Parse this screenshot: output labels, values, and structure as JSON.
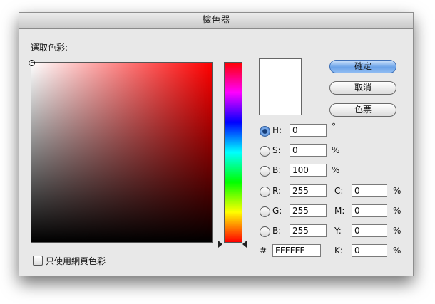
{
  "window": {
    "title": "檢色器"
  },
  "picker": {
    "label": "選取色彩:"
  },
  "buttons": {
    "ok": "確定",
    "cancel": "取消",
    "swatches": "色票"
  },
  "hsb": {
    "h": {
      "label": "H:",
      "value": "0",
      "unit": "°",
      "selected": true
    },
    "s": {
      "label": "S:",
      "value": "0",
      "unit": "%"
    },
    "b": {
      "label": "B:",
      "value": "100",
      "unit": "%"
    }
  },
  "rgb": {
    "r": {
      "label": "R:",
      "value": "255"
    },
    "g": {
      "label": "G:",
      "value": "255"
    },
    "b": {
      "label": "B:",
      "value": "255"
    }
  },
  "cmyk": {
    "c": {
      "label": "C:",
      "value": "0",
      "unit": "%"
    },
    "m": {
      "label": "M:",
      "value": "0",
      "unit": "%"
    },
    "y": {
      "label": "Y:",
      "value": "0",
      "unit": "%"
    },
    "k": {
      "label": "K:",
      "value": "0",
      "unit": "%"
    }
  },
  "hex": {
    "label": "#",
    "value": "FFFFFF"
  },
  "webonly": {
    "label": "只使用網頁色彩",
    "checked": false
  },
  "colors": {
    "current": "#ffffff",
    "hue": "#ff0000",
    "accent": "#6aa2e8"
  }
}
